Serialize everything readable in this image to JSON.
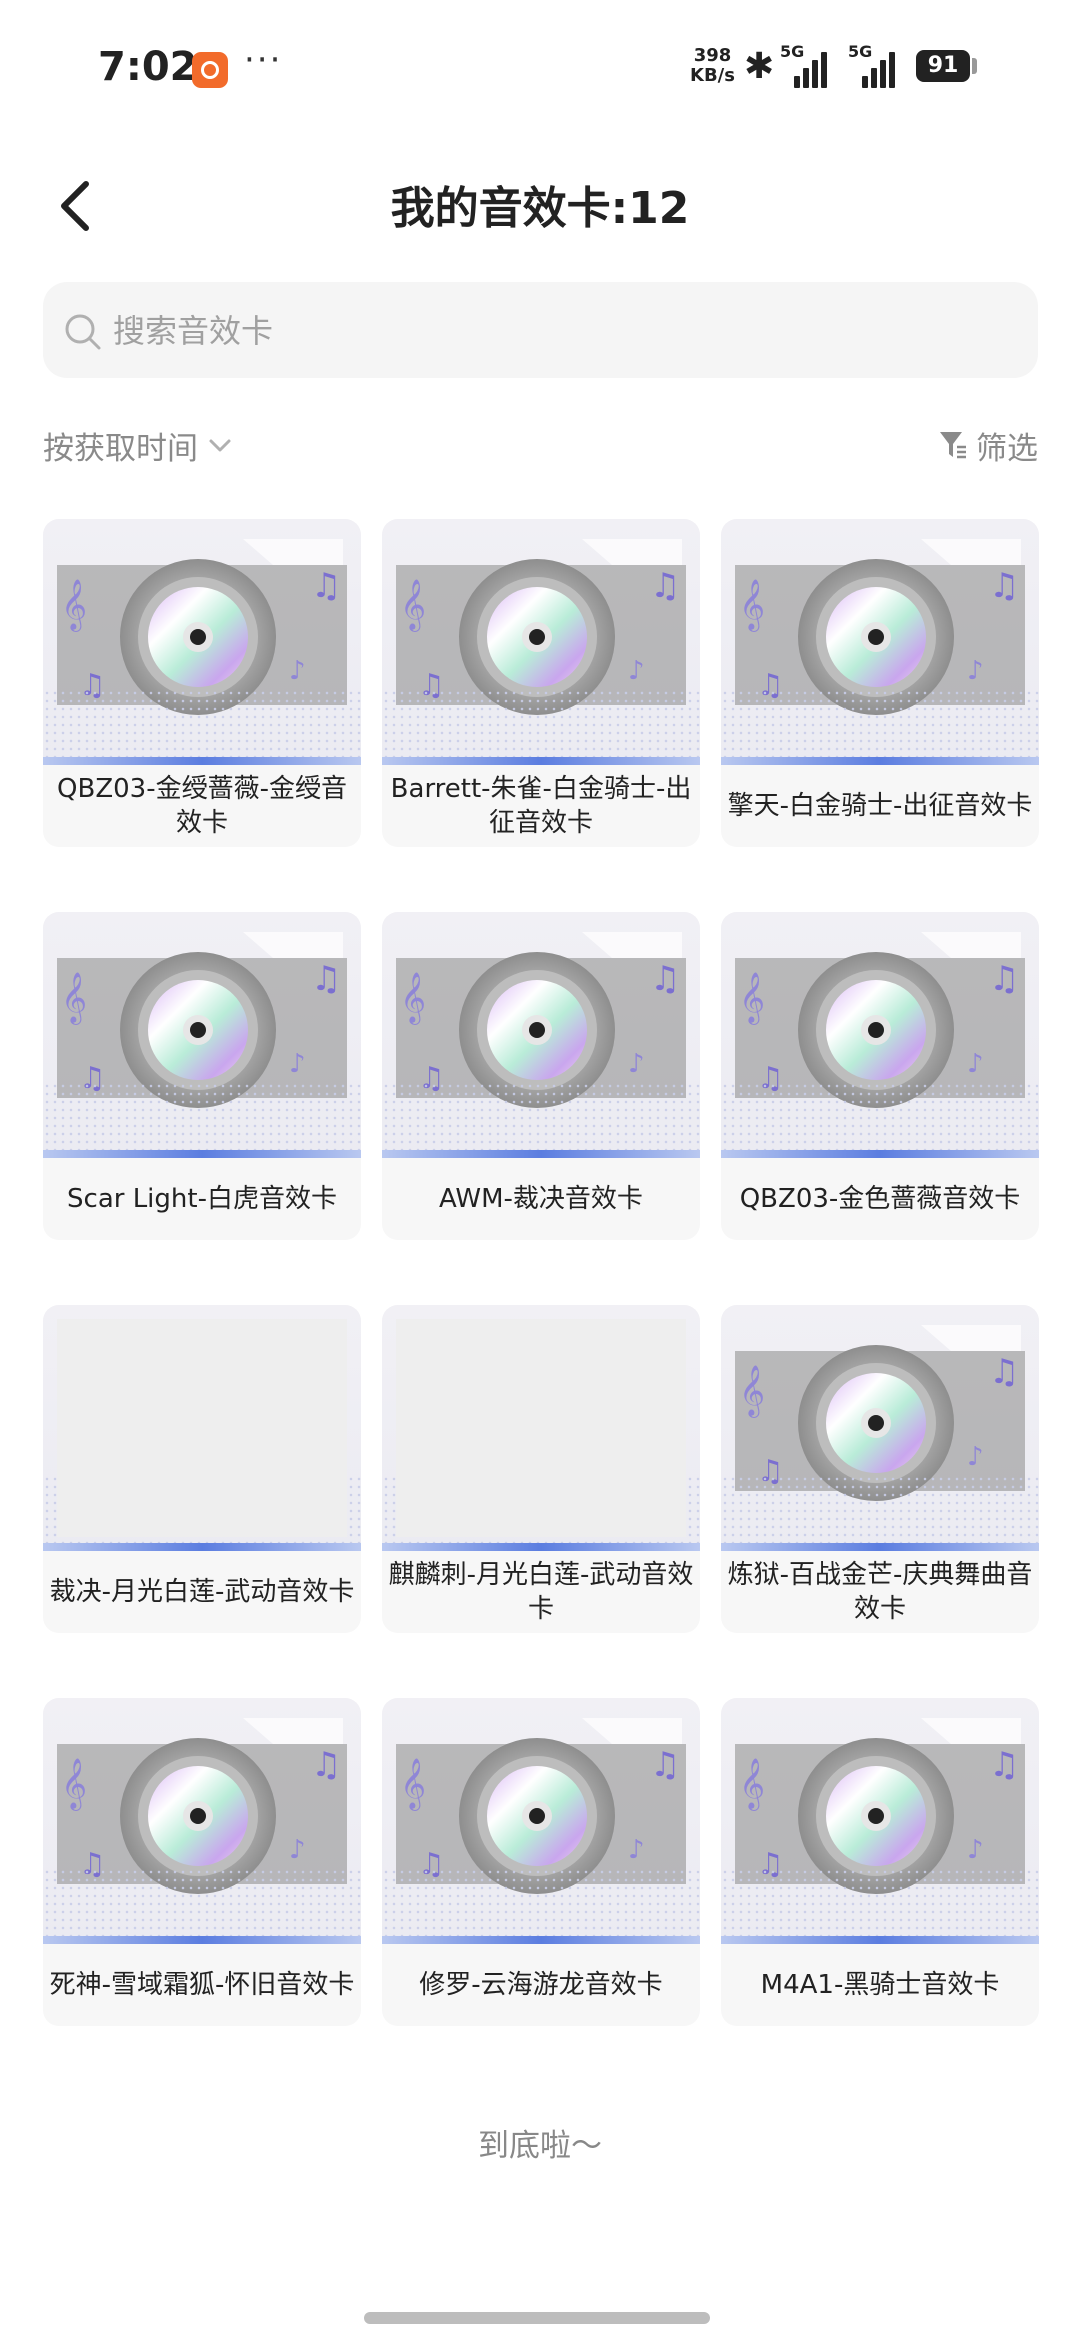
{
  "status_bar": {
    "time": "7:02",
    "speed_value": "398",
    "speed_unit": "KB/s",
    "sim1_label": "5G",
    "sim2_label": "5G",
    "battery": "91"
  },
  "header": {
    "title": "我的音效卡:12"
  },
  "search": {
    "placeholder": "搜索音效卡"
  },
  "toolbar": {
    "sort_label": "按获取时间",
    "filter_label": "筛选"
  },
  "cards": [
    {
      "name": "QBZ03-金绶蔷薇-金绶音效卡",
      "has_image": true
    },
    {
      "name": "Barrett-朱雀-白金骑士-出征音效卡",
      "has_image": true
    },
    {
      "name": "擎天-白金骑士-出征音效卡",
      "has_image": true
    },
    {
      "name": "Scar Light-白虎音效卡",
      "has_image": true
    },
    {
      "name": "AWM-裁决音效卡",
      "has_image": true
    },
    {
      "name": "QBZ03-金色蔷薇音效卡",
      "has_image": true
    },
    {
      "name": "裁决-月光白莲-武动音效卡",
      "has_image": false
    },
    {
      "name": "麒麟刺-月光白莲-武动音效卡",
      "has_image": false
    },
    {
      "name": "炼狱-百战金芒-庆典舞曲音效卡",
      "has_image": true
    },
    {
      "name": "死神-雪域霜狐-怀旧音效卡",
      "has_image": true
    },
    {
      "name": "修罗-云海游龙音效卡",
      "has_image": true
    },
    {
      "name": "M4A1-黑骑士音效卡",
      "has_image": true
    }
  ],
  "footer": {
    "end_text": "到底啦～"
  },
  "colors": {
    "accent_stripe": "#5b7de0",
    "card_bg": "#f7f7f7",
    "search_bg": "#f5f5f5"
  }
}
